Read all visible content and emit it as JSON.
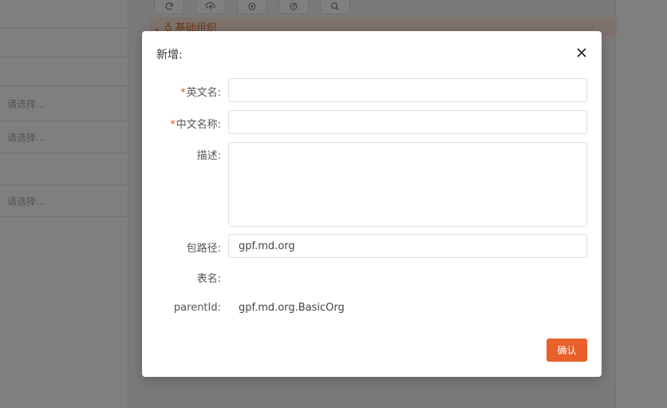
{
  "background": {
    "select_placeholder": "请选择...",
    "tree_header": "基础组织",
    "toolbar_icons": [
      "refresh-icon",
      "upload-icon",
      "locate-icon",
      "edit-icon",
      "search-icon"
    ]
  },
  "modal": {
    "title": "新增:",
    "close_icon": "close-icon",
    "fields": {
      "english_name": {
        "label": "英文名:",
        "required": "*",
        "value": ""
      },
      "chinese_name": {
        "label": "中文名称:",
        "required": "*",
        "value": ""
      },
      "description": {
        "label": "描述:",
        "value": ""
      },
      "package_path": {
        "label": "包路径:",
        "value": "gpf.md.org"
      },
      "table_name": {
        "label": "表名:",
        "value": ""
      },
      "parent_id": {
        "label": "parentId:",
        "value": "gpf.md.org.BasicOrg"
      }
    },
    "confirm_label": "确认"
  },
  "colors": {
    "accent": "#e8602a",
    "mask": "rgba(0,0,0,0.5)"
  }
}
